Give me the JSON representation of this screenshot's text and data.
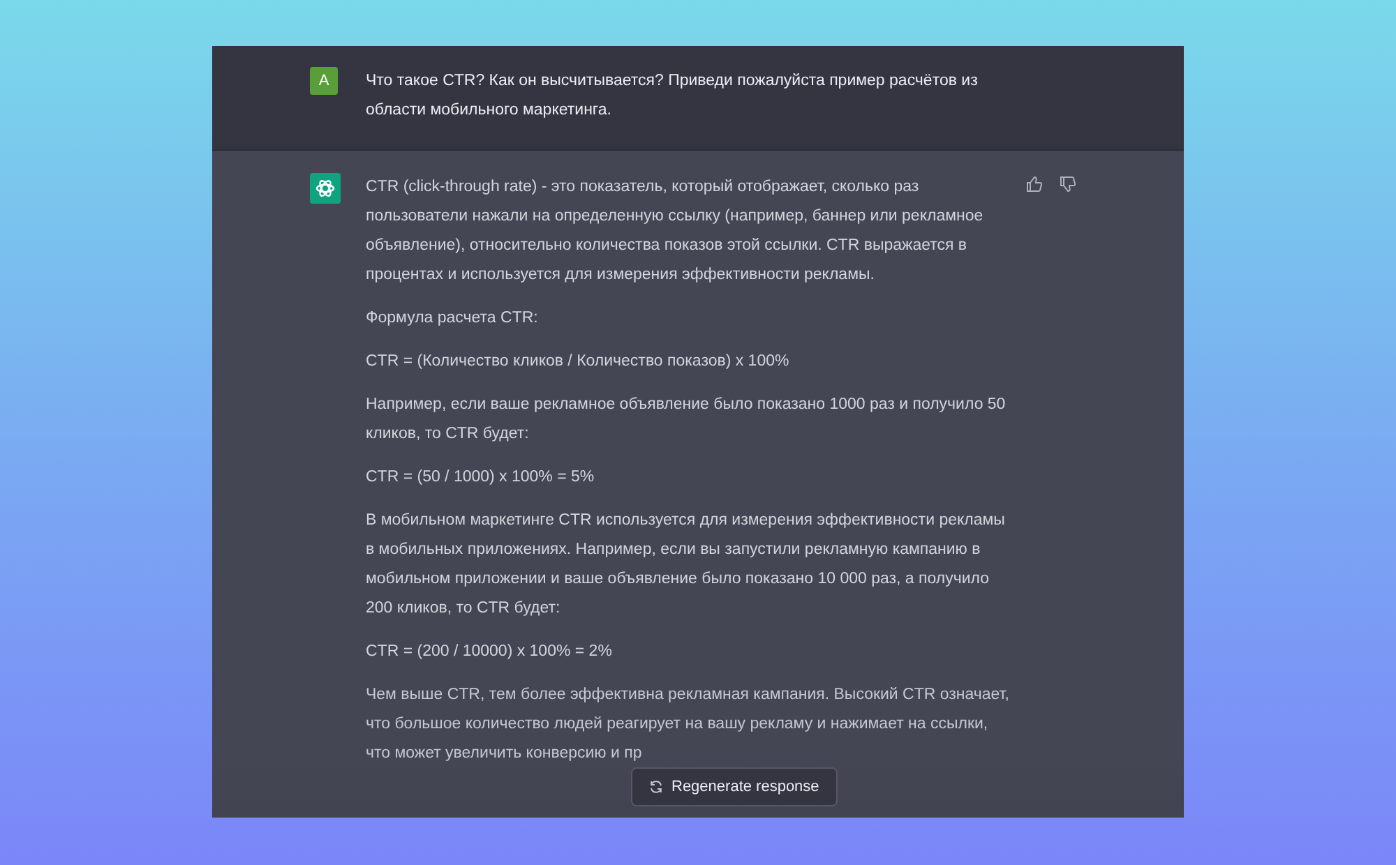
{
  "user_message": {
    "avatar": "A",
    "text": "Что такое CTR? Как он высчитывается? Приведи пожалуйста пример расчётов из области мобильного маркетинга."
  },
  "assistant_message": {
    "paragraphs": [
      "CTR (click-through rate) - это показатель, который отображает, сколько раз пользователи нажали на определенную ссылку (например, баннер или рекламное объявление), относительно количества показов этой ссылки. CTR выражается в процентах и используется для измерения эффективности рекламы.",
      "Формула расчета CTR:",
      "CTR = (Количество кликов / Количество показов) x 100%",
      "Например, если ваше рекламное объявление было показано 1000 раз и получило 50 кликов, то CTR будет:",
      "CTR = (50 / 1000) x 100% = 5%",
      "В мобильном маркетинге CTR используется для измерения эффективности рекламы в мобильных приложениях. Например, если вы запустили рекламную кампанию в мобильном приложении и ваше объявление было показано 10 000 раз, а получило 200 кликов, то CTR будет:",
      "CTR = (200 / 10000) x 100% = 2%",
      "Чем выше CTR, тем более эффективна рекламная кампания. Высокий CTR означает, что большое количество людей реагирует на вашу рекламу и нажимает на ссылки, что может увеличить конверсию и пр"
    ]
  },
  "regenerate_button": "Regenerate response"
}
